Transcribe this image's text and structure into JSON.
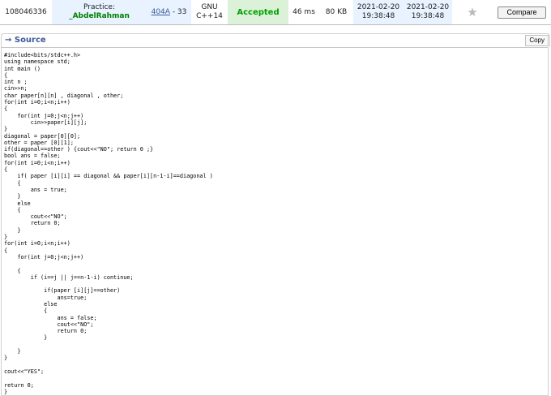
{
  "submission": {
    "id": "108046336",
    "party_prefix": "Practice:",
    "party_user": "_AbdelRahman",
    "problem_link": "404A",
    "problem_rest": " - 33",
    "lang_line1": "GNU",
    "lang_line2": "C++14",
    "verdict": "Accepted",
    "time": "46 ms",
    "memory": "80 KB",
    "submitted_date": "2021-02-20",
    "submitted_time": "19:38:48",
    "judged_date": "2021-02-20",
    "judged_time": "19:38:48",
    "favorite_icon": "star-icon",
    "compare_label": "Compare"
  },
  "source": {
    "title": "→ Source",
    "copy_label": "Copy",
    "code_lines": [
      "#include<bits/stdc++.h>",
      "using namespace std;",
      "int main ()",
      "{",
      "int n ;",
      "cin>>n;",
      "char paper[n][n] , diagonal , other;",
      "for(int i=0;i<n;i++)",
      "{",
      "    for(int j=0;j<n;j++)",
      "        cin>>paper[i][j];",
      "}",
      "diagonal = paper[0][0];",
      "other = paper [0][1];",
      "if(diagonal==other ) {cout<<\"NO\"; return 0 ;}",
      "bool ans = false;",
      "for(int i=0;i<n;i++)",
      "{",
      "    if( paper [i][i] == diagonal && paper[i][n-1-i]==diagonal )",
      "    {",
      "        ans = true;",
      "    }",
      "    else",
      "    {",
      "        cout<<\"NO\";",
      "        return 0;",
      "    }",
      "}",
      "for(int i=0;i<n;i++)",
      "{",
      "    for(int j=0;j<n;j++)",
      "",
      "    {",
      "        if (i==j || j==n-1-i) continue;",
      "",
      "            if(paper [i][j]==other)",
      "                ans=true;",
      "            else",
      "            {",
      "                ans = false;",
      "                cout<<\"NO\";",
      "                return 0;",
      "            }",
      "",
      "    }",
      "}",
      "",
      "cout<<\"YES\";",
      "",
      "return 0;",
      "}"
    ]
  }
}
